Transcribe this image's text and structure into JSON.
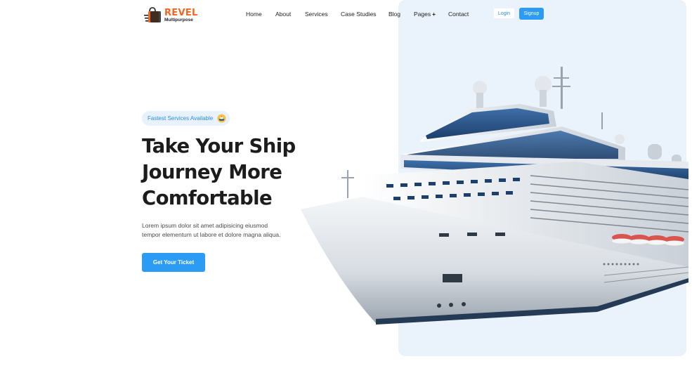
{
  "brand": {
    "name": "REVEL",
    "tagline": "Multipurpose",
    "color": "#f26522"
  },
  "nav": {
    "items": [
      {
        "id": "home",
        "label": "Home"
      },
      {
        "id": "about",
        "label": "About"
      },
      {
        "id": "services",
        "label": "Services"
      },
      {
        "id": "case-studies",
        "label": "Case Studies"
      },
      {
        "id": "blog",
        "label": "Blog"
      },
      {
        "id": "pages",
        "label": "Pages"
      },
      {
        "id": "contact",
        "label": "Contact"
      }
    ],
    "login_label": "Login",
    "signup_label": "Signup"
  },
  "hero": {
    "badge_text": "Fastest Services Available",
    "badge_icon": "ship-icon",
    "title_lines": [
      "Take Your Ship",
      "Journey More",
      "Comfortable"
    ],
    "description_lines": [
      "Lorem ipsum dolor sit amet adipisicing eiusmod",
      "tempor elementum ut labore et dolore magna aliqua."
    ],
    "cta_label": "Get Your Ticket",
    "image": "cruise-ship-illustration"
  },
  "colors": {
    "accent": "#2b9bf4",
    "panel": "#eaf3fc",
    "heading": "#1c1c1c"
  }
}
